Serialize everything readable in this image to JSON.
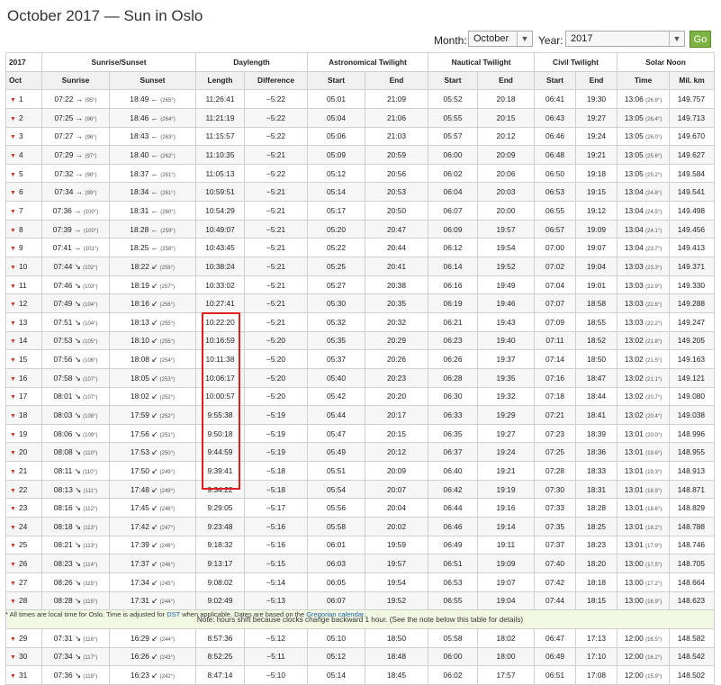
{
  "title": "October 2017 — Sun in Oslo",
  "controls": {
    "month_label": "Month:",
    "month_value": "October",
    "year_label": "Year:",
    "year_value": "2017",
    "go_label": "Go"
  },
  "header": {
    "year": "2017",
    "groups": [
      "Sunrise/Sunset",
      "Daylength",
      "Astronomical Twilight",
      "Nautical Twilight",
      "Civil Twilight",
      "Solar Noon"
    ],
    "sub": [
      "Oct",
      "Sunrise",
      "Sunset",
      "Length",
      "Difference",
      "Start",
      "End",
      "Start",
      "End",
      "Start",
      "End",
      "Time",
      "Mil. km"
    ]
  },
  "rows": [
    {
      "day": "1",
      "rise": "07:22",
      "rise_arrow": "→",
      "rise_deg": "(95°)",
      "set": "18:49",
      "set_arrow": "←",
      "set_deg": "(265°)",
      "length": "11:26:41",
      "diff": "−5:22",
      "as": "05:01",
      "ae": "21:09",
      "ns": "05:52",
      "ne": "20:18",
      "cs": "06:41",
      "ce": "19:30",
      "noon": "13:06",
      "noon_deg": "(26.8°)",
      "km": "149.757"
    },
    {
      "day": "2",
      "rise": "07:25",
      "rise_arrow": "→",
      "rise_deg": "(96°)",
      "set": "18:46",
      "set_arrow": "←",
      "set_deg": "(264°)",
      "length": "11:21:19",
      "diff": "−5:22",
      "as": "05:04",
      "ae": "21:06",
      "ns": "05:55",
      "ne": "20:15",
      "cs": "06:43",
      "ce": "19:27",
      "noon": "13:05",
      "noon_deg": "(26.4°)",
      "km": "149.713"
    },
    {
      "day": "3",
      "rise": "07:27",
      "rise_arrow": "→",
      "rise_deg": "(96°)",
      "set": "18:43",
      "set_arrow": "←",
      "set_deg": "(263°)",
      "length": "11:15:57",
      "diff": "−5:22",
      "as": "05:06",
      "ae": "21:03",
      "ns": "05:57",
      "ne": "20:12",
      "cs": "06:46",
      "ce": "19:24",
      "noon": "13:05",
      "noon_deg": "(26.0°)",
      "km": "149.670"
    },
    {
      "day": "4",
      "rise": "07:29",
      "rise_arrow": "→",
      "rise_deg": "(97°)",
      "set": "18:40",
      "set_arrow": "←",
      "set_deg": "(262°)",
      "length": "11:10:35",
      "diff": "−5:21",
      "as": "05:09",
      "ae": "20:59",
      "ns": "06:00",
      "ne": "20:09",
      "cs": "06:48",
      "ce": "19:21",
      "noon": "13:05",
      "noon_deg": "(25.6°)",
      "km": "149.627"
    },
    {
      "day": "5",
      "rise": "07:32",
      "rise_arrow": "→",
      "rise_deg": "(98°)",
      "set": "18:37",
      "set_arrow": "←",
      "set_deg": "(261°)",
      "length": "11:05:13",
      "diff": "−5:22",
      "as": "05:12",
      "ae": "20:56",
      "ns": "06:02",
      "ne": "20:06",
      "cs": "06:50",
      "ce": "19:18",
      "noon": "13:05",
      "noon_deg": "(25.2°)",
      "km": "149.584"
    },
    {
      "day": "6",
      "rise": "07:34",
      "rise_arrow": "→",
      "rise_deg": "(99°)",
      "set": "18:34",
      "set_arrow": "←",
      "set_deg": "(261°)",
      "length": "10:59:51",
      "diff": "−5:21",
      "as": "05:14",
      "ae": "20:53",
      "ns": "06:04",
      "ne": "20:03",
      "cs": "06:53",
      "ce": "19:15",
      "noon": "13:04",
      "noon_deg": "(24.8°)",
      "km": "149.541"
    },
    {
      "day": "7",
      "rise": "07:36",
      "rise_arrow": "→",
      "rise_deg": "(100°)",
      "set": "18:31",
      "set_arrow": "←",
      "set_deg": "(260°)",
      "length": "10:54:29",
      "diff": "−5:21",
      "as": "05:17",
      "ae": "20:50",
      "ns": "06:07",
      "ne": "20:00",
      "cs": "06:55",
      "ce": "19:12",
      "noon": "13:04",
      "noon_deg": "(24.5°)",
      "km": "149.498"
    },
    {
      "day": "8",
      "rise": "07:39",
      "rise_arrow": "→",
      "rise_deg": "(100°)",
      "set": "18:28",
      "set_arrow": "←",
      "set_deg": "(259°)",
      "length": "10:49:07",
      "diff": "−5:21",
      "as": "05:20",
      "ae": "20:47",
      "ns": "06:09",
      "ne": "19:57",
      "cs": "06:57",
      "ce": "19:09",
      "noon": "13:04",
      "noon_deg": "(24.1°)",
      "km": "149.456"
    },
    {
      "day": "9",
      "rise": "07:41",
      "rise_arrow": "→",
      "rise_deg": "(101°)",
      "set": "18:25",
      "set_arrow": "←",
      "set_deg": "(258°)",
      "length": "10:43:45",
      "diff": "−5:21",
      "as": "05:22",
      "ae": "20:44",
      "ns": "06:12",
      "ne": "19:54",
      "cs": "07:00",
      "ce": "19:07",
      "noon": "13:04",
      "noon_deg": "(23.7°)",
      "km": "149.413"
    },
    {
      "day": "10",
      "rise": "07:44",
      "rise_arrow": "↘",
      "rise_deg": "(102°)",
      "set": "18:22",
      "set_arrow": "↙",
      "set_deg": "(258°)",
      "length": "10:38:24",
      "diff": "−5:21",
      "as": "05:25",
      "ae": "20:41",
      "ns": "06:14",
      "ne": "19:52",
      "cs": "07:02",
      "ce": "19:04",
      "noon": "13:03",
      "noon_deg": "(23.3°)",
      "km": "149.371"
    },
    {
      "day": "11",
      "rise": "07:46",
      "rise_arrow": "↘",
      "rise_deg": "(103°)",
      "set": "18:19",
      "set_arrow": "↙",
      "set_deg": "(257°)",
      "length": "10:33:02",
      "diff": "−5:21",
      "as": "05:27",
      "ae": "20:38",
      "ns": "06:16",
      "ne": "19:49",
      "cs": "07:04",
      "ce": "19:01",
      "noon": "13:03",
      "noon_deg": "(22.9°)",
      "km": "149.330"
    },
    {
      "day": "12",
      "rise": "07:49",
      "rise_arrow": "↘",
      "rise_deg": "(104°)",
      "set": "18:16",
      "set_arrow": "↙",
      "set_deg": "(256°)",
      "length": "10:27:41",
      "diff": "−5:21",
      "as": "05:30",
      "ae": "20:35",
      "ns": "06:19",
      "ne": "19:46",
      "cs": "07:07",
      "ce": "18:58",
      "noon": "13:03",
      "noon_deg": "(22.6°)",
      "km": "149.288"
    },
    {
      "day": "13",
      "rise": "07:51",
      "rise_arrow": "↘",
      "rise_deg": "(104°)",
      "set": "18:13",
      "set_arrow": "↙",
      "set_deg": "(255°)",
      "length": "10:22:20",
      "diff": "−5:21",
      "as": "05:32",
      "ae": "20:32",
      "ns": "06:21",
      "ne": "19:43",
      "cs": "07:09",
      "ce": "18:55",
      "noon": "13:03",
      "noon_deg": "(22.2°)",
      "km": "149.247"
    },
    {
      "day": "14",
      "rise": "07:53",
      "rise_arrow": "↘",
      "rise_deg": "(105°)",
      "set": "18:10",
      "set_arrow": "↙",
      "set_deg": "(255°)",
      "length": "10:16:59",
      "diff": "−5:20",
      "as": "05:35",
      "ae": "20:29",
      "ns": "06:23",
      "ne": "19:40",
      "cs": "07:11",
      "ce": "18:52",
      "noon": "13:02",
      "noon_deg": "(21.8°)",
      "km": "149.205"
    },
    {
      "day": "15",
      "rise": "07:56",
      "rise_arrow": "↘",
      "rise_deg": "(106°)",
      "set": "18:08",
      "set_arrow": "↙",
      "set_deg": "(254°)",
      "length": "10:11:38",
      "diff": "−5:20",
      "as": "05:37",
      "ae": "20:26",
      "ns": "06:26",
      "ne": "19:37",
      "cs": "07:14",
      "ce": "18:50",
      "noon": "13:02",
      "noon_deg": "(21.5°)",
      "km": "149.163"
    },
    {
      "day": "16",
      "rise": "07:58",
      "rise_arrow": "↘",
      "rise_deg": "(107°)",
      "set": "18:05",
      "set_arrow": "↙",
      "set_deg": "(253°)",
      "length": "10:06:17",
      "diff": "−5:20",
      "as": "05:40",
      "ae": "20:23",
      "ns": "06:28",
      "ne": "19:35",
      "cs": "07:16",
      "ce": "18:47",
      "noon": "13:02",
      "noon_deg": "(21.1°)",
      "km": "149.121"
    },
    {
      "day": "17",
      "rise": "08:01",
      "rise_arrow": "↘",
      "rise_deg": "(107°)",
      "set": "18:02",
      "set_arrow": "↙",
      "set_deg": "(252°)",
      "length": "10:00:57",
      "diff": "−5:20",
      "as": "05:42",
      "ae": "20:20",
      "ns": "06:30",
      "ne": "19:32",
      "cs": "07:18",
      "ce": "18:44",
      "noon": "13:02",
      "noon_deg": "(20.7°)",
      "km": "149.080"
    },
    {
      "day": "18",
      "rise": "08:03",
      "rise_arrow": "↘",
      "rise_deg": "(108°)",
      "set": "17:59",
      "set_arrow": "↙",
      "set_deg": "(252°)",
      "length": "9:55:38",
      "diff": "−5:19",
      "as": "05:44",
      "ae": "20:17",
      "ns": "06:33",
      "ne": "19:29",
      "cs": "07:21",
      "ce": "18:41",
      "noon": "13:02",
      "noon_deg": "(20.4°)",
      "km": "149.038"
    },
    {
      "day": "19",
      "rise": "08:06",
      "rise_arrow": "↘",
      "rise_deg": "(109°)",
      "set": "17:56",
      "set_arrow": "↙",
      "set_deg": "(251°)",
      "length": "9:50:18",
      "diff": "−5:19",
      "as": "05:47",
      "ae": "20:15",
      "ns": "06:35",
      "ne": "19:27",
      "cs": "07:23",
      "ce": "18:39",
      "noon": "13:01",
      "noon_deg": "(20.0°)",
      "km": "148.996"
    },
    {
      "day": "20",
      "rise": "08:08",
      "rise_arrow": "↘",
      "rise_deg": "(110°)",
      "set": "17:53",
      "set_arrow": "↙",
      "set_deg": "(250°)",
      "length": "9:44:59",
      "diff": "−5:19",
      "as": "05:49",
      "ae": "20:12",
      "ns": "06:37",
      "ne": "19:24",
      "cs": "07:25",
      "ce": "18:36",
      "noon": "13:01",
      "noon_deg": "(19.6°)",
      "km": "148.955"
    },
    {
      "day": "21",
      "rise": "08:11",
      "rise_arrow": "↘",
      "rise_deg": "(110°)",
      "set": "17:50",
      "set_arrow": "↙",
      "set_deg": "(249°)",
      "length": "9:39:41",
      "diff": "−5:18",
      "as": "05:51",
      "ae": "20:09",
      "ns": "06:40",
      "ne": "19:21",
      "cs": "07:28",
      "ce": "18:33",
      "noon": "13:01",
      "noon_deg": "(19.3°)",
      "km": "148.913"
    },
    {
      "day": "22",
      "rise": "08:13",
      "rise_arrow": "↘",
      "rise_deg": "(111°)",
      "set": "17:48",
      "set_arrow": "↙",
      "set_deg": "(249°)",
      "length": "9:34:22",
      "diff": "−5:18",
      "as": "05:54",
      "ae": "20:07",
      "ns": "06:42",
      "ne": "19:19",
      "cs": "07:30",
      "ce": "18:31",
      "noon": "13:01",
      "noon_deg": "(18.9°)",
      "km": "148.871"
    },
    {
      "day": "23",
      "rise": "08:16",
      "rise_arrow": "↘",
      "rise_deg": "(112°)",
      "set": "17:45",
      "set_arrow": "↙",
      "set_deg": "(248°)",
      "length": "9:29:05",
      "diff": "−5:17",
      "as": "05:56",
      "ae": "20:04",
      "ns": "06:44",
      "ne": "19:16",
      "cs": "07:33",
      "ce": "18:28",
      "noon": "13:01",
      "noon_deg": "(18.6°)",
      "km": "148.829"
    },
    {
      "day": "24",
      "rise": "08:18",
      "rise_arrow": "↘",
      "rise_deg": "(113°)",
      "set": "17:42",
      "set_arrow": "↙",
      "set_deg": "(247°)",
      "length": "9:23:48",
      "diff": "−5:16",
      "as": "05:58",
      "ae": "20:02",
      "ns": "06:46",
      "ne": "19:14",
      "cs": "07:35",
      "ce": "18:25",
      "noon": "13:01",
      "noon_deg": "(18.2°)",
      "km": "148.788"
    },
    {
      "day": "25",
      "rise": "08:21",
      "rise_arrow": "↘",
      "rise_deg": "(113°)",
      "set": "17:39",
      "set_arrow": "↙",
      "set_deg": "(246°)",
      "length": "9:18:32",
      "diff": "−5:16",
      "as": "06:01",
      "ae": "19:59",
      "ns": "06:49",
      "ne": "19:11",
      "cs": "07:37",
      "ce": "18:23",
      "noon": "13:01",
      "noon_deg": "(17.9°)",
      "km": "148.746"
    },
    {
      "day": "26",
      "rise": "08:23",
      "rise_arrow": "↘",
      "rise_deg": "(114°)",
      "set": "17:37",
      "set_arrow": "↙",
      "set_deg": "(246°)",
      "length": "9:13:17",
      "diff": "−5:15",
      "as": "06:03",
      "ae": "19:57",
      "ns": "06:51",
      "ne": "19:09",
      "cs": "07:40",
      "ce": "18:20",
      "noon": "13:00",
      "noon_deg": "(17.5°)",
      "km": "148.705"
    },
    {
      "day": "27",
      "rise": "08:26",
      "rise_arrow": "↘",
      "rise_deg": "(115°)",
      "set": "17:34",
      "set_arrow": "↙",
      "set_deg": "(245°)",
      "length": "9:08:02",
      "diff": "−5:14",
      "as": "06:05",
      "ae": "19:54",
      "ns": "06:53",
      "ne": "19:07",
      "cs": "07:42",
      "ce": "18:18",
      "noon": "13:00",
      "noon_deg": "(17.2°)",
      "km": "148.664"
    },
    {
      "day": "28",
      "rise": "08:28",
      "rise_arrow": "↘",
      "rise_deg": "(115°)",
      "set": "17:31",
      "set_arrow": "↙",
      "set_deg": "(244°)",
      "length": "9:02:49",
      "diff": "−5:13",
      "as": "06:07",
      "ae": "19:52",
      "ns": "06:55",
      "ne": "19:04",
      "cs": "07:44",
      "ce": "18:15",
      "noon": "13:00",
      "noon_deg": "(16.9°)",
      "km": "148.623"
    },
    {
      "note": "Note: hours shift because clocks change backward 1 hour. (See the note below this table for details)"
    },
    {
      "day": "29",
      "rise": "07:31",
      "rise_arrow": "↘",
      "rise_deg": "(116°)",
      "set": "16:29",
      "set_arrow": "↙",
      "set_deg": "(244°)",
      "length": "8:57:36",
      "diff": "−5:12",
      "as": "05:10",
      "ae": "18:50",
      "ns": "05:58",
      "ne": "18:02",
      "cs": "06:47",
      "ce": "17:13",
      "noon": "12:00",
      "noon_deg": "(16.5°)",
      "km": "148.582"
    },
    {
      "day": "30",
      "rise": "07:34",
      "rise_arrow": "↘",
      "rise_deg": "(117°)",
      "set": "16:26",
      "set_arrow": "↙",
      "set_deg": "(243°)",
      "length": "8:52:25",
      "diff": "−5:11",
      "as": "05:12",
      "ae": "18:48",
      "ns": "06:00",
      "ne": "18:00",
      "cs": "06:49",
      "ce": "17:10",
      "noon": "12:00",
      "noon_deg": "(16.2°)",
      "km": "148.542"
    },
    {
      "day": "31",
      "rise": "07:36",
      "rise_arrow": "↘",
      "rise_deg": "(118°)",
      "set": "16:23",
      "set_arrow": "↙",
      "set_deg": "(242°)",
      "length": "8:47:14",
      "diff": "−5:10",
      "as": "05:14",
      "ae": "18:45",
      "ns": "06:02",
      "ne": "17:57",
      "cs": "06:51",
      "ce": "17:08",
      "noon": "12:00",
      "noon_deg": "(15.9°)",
      "km": "148.502"
    }
  ],
  "footer": {
    "pre": "* All times are local time for Oslo. Time is adjusted for ",
    "dst_link": "DST",
    "mid": " when applicable. Dates are based on the ",
    "cal_link": "Gregorian calendar",
    "post": "."
  },
  "icons": {
    "row_toggle": "caret-down-icon",
    "select_arrow": "chevron-down-icon"
  },
  "colors": {
    "go_button": "#7cb342",
    "highlight": "#e01e1e",
    "note_bg": "#f2f9e3",
    "toggle": "#c0392b",
    "link": "#1a5ea8"
  }
}
